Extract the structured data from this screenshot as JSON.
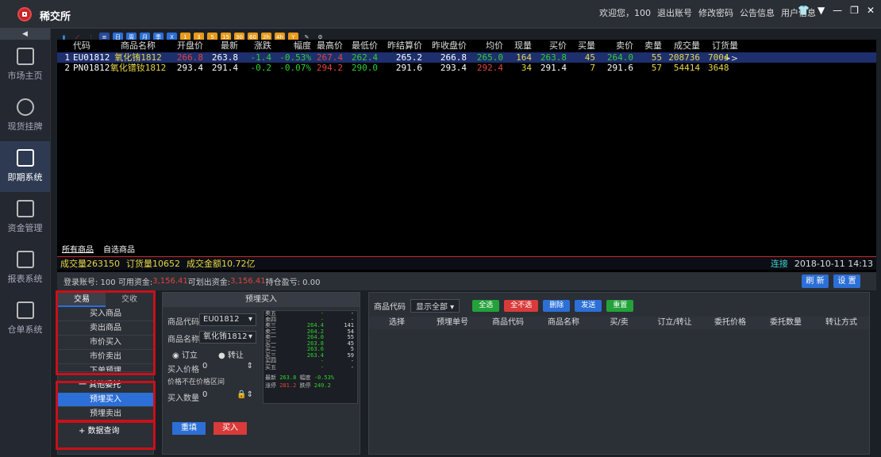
{
  "app": {
    "title": "稀交所"
  },
  "topmenu": {
    "welcome": "欢迎您，100",
    "logout": "退出账号",
    "change_pwd": "修改密码",
    "notice": "公告信息",
    "userinfo": "用户信息"
  },
  "nav": {
    "collapse": "◀",
    "items": [
      {
        "label": "市场主页",
        "icon": "home-icon"
      },
      {
        "label": "现货挂牌",
        "icon": "yuan-circle-icon"
      },
      {
        "label": "即期系统",
        "icon": "yuan-box-icon"
      },
      {
        "label": "资金管理",
        "icon": "calendar-icon"
      },
      {
        "label": "报表系统",
        "icon": "report-icon"
      },
      {
        "label": "仓单系统",
        "icon": "warehouse-icon"
      }
    ]
  },
  "toolbar": {
    "icons": [
      {
        "name": "bar-chart-icon",
        "bg": "#1b1f26",
        "color": "#3a8ee6",
        "text": "▮"
      },
      {
        "name": "line-chart-icon",
        "bg": "#1b1f26",
        "color": "#e0443c",
        "text": "⟋"
      },
      {
        "name": "candle-chart-icon",
        "bg": "#1b1f26",
        "color": "#2fd02f",
        "text": "⫶"
      },
      {
        "name": "list-icon",
        "bg": "#2a4a9a",
        "color": "#fff",
        "text": "≡"
      },
      {
        "name": "day-icon",
        "bg": "#2c6fd6",
        "color": "#fff",
        "text": "日"
      },
      {
        "name": "week-icon",
        "bg": "#2c6fd6",
        "color": "#fff",
        "text": "周"
      },
      {
        "name": "month-icon",
        "bg": "#2c6fd6",
        "color": "#fff",
        "text": "月"
      },
      {
        "name": "quarter-icon",
        "bg": "#2c6fd6",
        "color": "#fff",
        "text": "季"
      },
      {
        "name": "year-icon",
        "bg": "#2c6fd6",
        "color": "#fff",
        "text": "X"
      },
      {
        "name": "1min-icon",
        "bg": "#e89a1a",
        "color": "#fff",
        "text": "1"
      },
      {
        "name": "3min-icon",
        "bg": "#e89a1a",
        "color": "#fff",
        "text": "3"
      },
      {
        "name": "5min-icon",
        "bg": "#e89a1a",
        "color": "#fff",
        "text": "5"
      },
      {
        "name": "15min-icon",
        "bg": "#e89a1a",
        "color": "#fff",
        "text": "15"
      },
      {
        "name": "30min-icon",
        "bg": "#e89a1a",
        "color": "#fff",
        "text": "30"
      },
      {
        "name": "60min-icon",
        "bg": "#e89a1a",
        "color": "#fff",
        "text": "60"
      },
      {
        "name": "2h-icon",
        "bg": "#e89a1a",
        "color": "#fff",
        "text": "2h"
      },
      {
        "name": "4h-icon",
        "bg": "#e89a1a",
        "color": "#fff",
        "text": "4h"
      },
      {
        "name": "year-y-icon",
        "bg": "#e89a1a",
        "color": "#fff",
        "text": "Y"
      },
      {
        "name": "draw-icon",
        "bg": "#1b1f26",
        "color": "#ddd",
        "text": "✎"
      },
      {
        "name": "settings-gear-icon",
        "bg": "#1b1f26",
        "color": "#ddd",
        "text": "⚙"
      }
    ]
  },
  "quote": {
    "headers": [
      "",
      "代码",
      "商品名称",
      "开盘价",
      "最新",
      "涨跌",
      "幅度",
      "最高价",
      "最低价",
      "昨结算价",
      "昨收盘价",
      "均价",
      "现量",
      "买价",
      "买量",
      "卖价",
      "卖量",
      "成交量",
      "订货量 >>"
    ],
    "rows": [
      [
        "1",
        "EU01812",
        "氧化铕1812",
        "266.8",
        "263.8",
        "-1.4",
        "-0.53%",
        "267.4",
        "262.4",
        "265.2",
        "266.8",
        "265.0",
        "164",
        "263.8",
        "45",
        "264.0",
        "55",
        "208736",
        "7004"
      ],
      [
        "2",
        "PN01812",
        "氧化镨钕1812",
        "293.4",
        "291.4",
        "-0.2",
        "-0.07%",
        "294.2",
        "290.0",
        "291.6",
        "293.4",
        "292.4",
        "34",
        "291.4",
        "7",
        "291.6",
        "57",
        "54414",
        "3648"
      ]
    ],
    "colors": [
      [
        "white",
        "white",
        "yellow",
        "red",
        "white",
        "green",
        "green",
        "red",
        "green",
        "white",
        "white",
        "green",
        "yellow",
        "green",
        "yellow",
        "green",
        "yellow",
        "yellow",
        "yellow"
      ],
      [
        "white",
        "white",
        "yellow",
        "white",
        "white",
        "green",
        "green",
        "red",
        "green",
        "white",
        "white",
        "red",
        "yellow",
        "white",
        "yellow",
        "white",
        "yellow",
        "yellow",
        "yellow"
      ]
    ]
  },
  "tabs": {
    "all": "所有商品",
    "fav": "自选商品"
  },
  "status": {
    "volume": "成交量263150",
    "order": "订货量10652",
    "amount": "成交金额10.72亿",
    "conn": "连接",
    "time": "2018-10-11 14:13"
  },
  "account": {
    "text": "登录账号: 100 可用资金: ",
    "avail": "3,156.41",
    "transfer_label": " 可划出资金: ",
    "transfer": "3,156.41",
    "pos": " 持仓盈亏: 0.00",
    "refresh": "刷 新",
    "settings": "设 置"
  },
  "sidemenu": {
    "tab_trade": "交易",
    "tab_deliver": "交收",
    "items": [
      "买入商品",
      "卖出商品",
      "市价买入",
      "市价卖出",
      "下单预埋"
    ],
    "group_other": "一 其他委托",
    "sub_buy": "预埋买入",
    "sub_sell": "预埋卖出",
    "group_query": "+ 数据查询"
  },
  "order": {
    "title": "预埋买入",
    "code_label": "商品代码",
    "code_value": "EU01812",
    "name_label": "商品名称",
    "name_value": "氧化铕1812",
    "radio_open": "订立",
    "radio_transfer": "转让",
    "price_label": "买入价格",
    "price_value": "0",
    "price_hint": "价格不在价格区间",
    "qty_label": "买入数量",
    "qty_value": "0",
    "reset": "重填",
    "buy": "买入"
  },
  "depth": {
    "rows": [
      [
        "卖五",
        "-",
        "-"
      ],
      [
        "卖四",
        "-",
        "-"
      ],
      [
        "卖三",
        "264.4",
        "141"
      ],
      [
        "卖二",
        "264.2",
        "54"
      ],
      [
        "卖一",
        "264.0",
        "55"
      ],
      [
        "买一",
        "263.8",
        "45"
      ],
      [
        "买二",
        "263.6",
        "5"
      ],
      [
        "买三",
        "263.4",
        "59"
      ],
      [
        "买四",
        "-",
        "-"
      ],
      [
        "买五",
        "-",
        "-"
      ]
    ],
    "latest_label": "最新",
    "latest": "263.8",
    "amp_label": "幅度",
    "amp": "-0.53%",
    "limitup_label": "涨停",
    "limitup": "281.2",
    "limitdown_label": "跌停",
    "limitdown": "249.2"
  },
  "list": {
    "code_label": "商品代码",
    "filter": "显示全部",
    "select_all": "全选",
    "select_none": "全不选",
    "delete": "删除",
    "send": "发送",
    "reset": "重置",
    "headers": [
      "选择",
      "预埋单号",
      "商品代码",
      "商品名称",
      "买/卖",
      "订立/转让",
      "委托价格",
      "委托数量",
      "转让方式"
    ]
  }
}
